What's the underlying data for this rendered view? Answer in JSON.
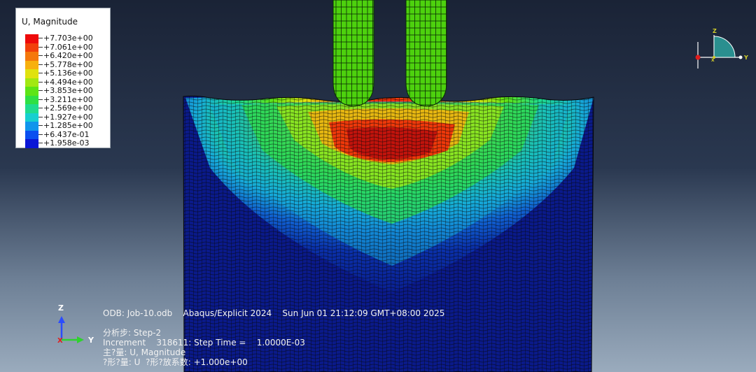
{
  "legend": {
    "title": "U, Magnitude",
    "entries": [
      {
        "label": "+7.703e+00",
        "color": "#ee0a0a"
      },
      {
        "label": "+7.061e+00",
        "color": "#f2400b"
      },
      {
        "label": "+6.420e+00",
        "color": "#f5780c"
      },
      {
        "label": "+5.778e+00",
        "color": "#f7b00e"
      },
      {
        "label": "+5.136e+00",
        "color": "#e0e20f"
      },
      {
        "label": "+4.494e+00",
        "color": "#a2e812"
      },
      {
        "label": "+3.853e+00",
        "color": "#5de416"
      },
      {
        "label": "+3.211e+00",
        "color": "#2ee044"
      },
      {
        "label": "+2.569e+00",
        "color": "#1edc8e"
      },
      {
        "label": "+1.927e+00",
        "color": "#16cfd0"
      },
      {
        "label": "+1.285e+00",
        "color": "#1095ec"
      },
      {
        "label": "+6.437e-01",
        "color": "#0a4ff0"
      },
      {
        "label": "+1.958e-03",
        "color": "#0a16d6"
      }
    ]
  },
  "info": {
    "odb_line": "ODB: Job-10.odb    Abaqus/Explicit 2024    Sun Jun 01 21:12:09 GMT+08:00 2025",
    "step_line": "分析步: Step-2",
    "increment_line": "Increment    318611: Step Time =    1.0000E-03",
    "primary_var_line": "主?量: U, Magnitude",
    "deformed_var_line": "?形?量: U  ?形?放系数: +1.000e+00"
  },
  "triad": {
    "z_label": "Z",
    "y_label": "Y",
    "x_label": "X",
    "z_color": "#2b4cff",
    "y_color": "#2fd12f",
    "x_color": "#e01c1c"
  },
  "view_cube": {
    "z_label": "Z",
    "y_label": "Y",
    "x_label": "X"
  },
  "model": {
    "part_color": "#4dd10e",
    "mesh_color": "#0b0b0b",
    "base_color": "#0a1a8a"
  }
}
